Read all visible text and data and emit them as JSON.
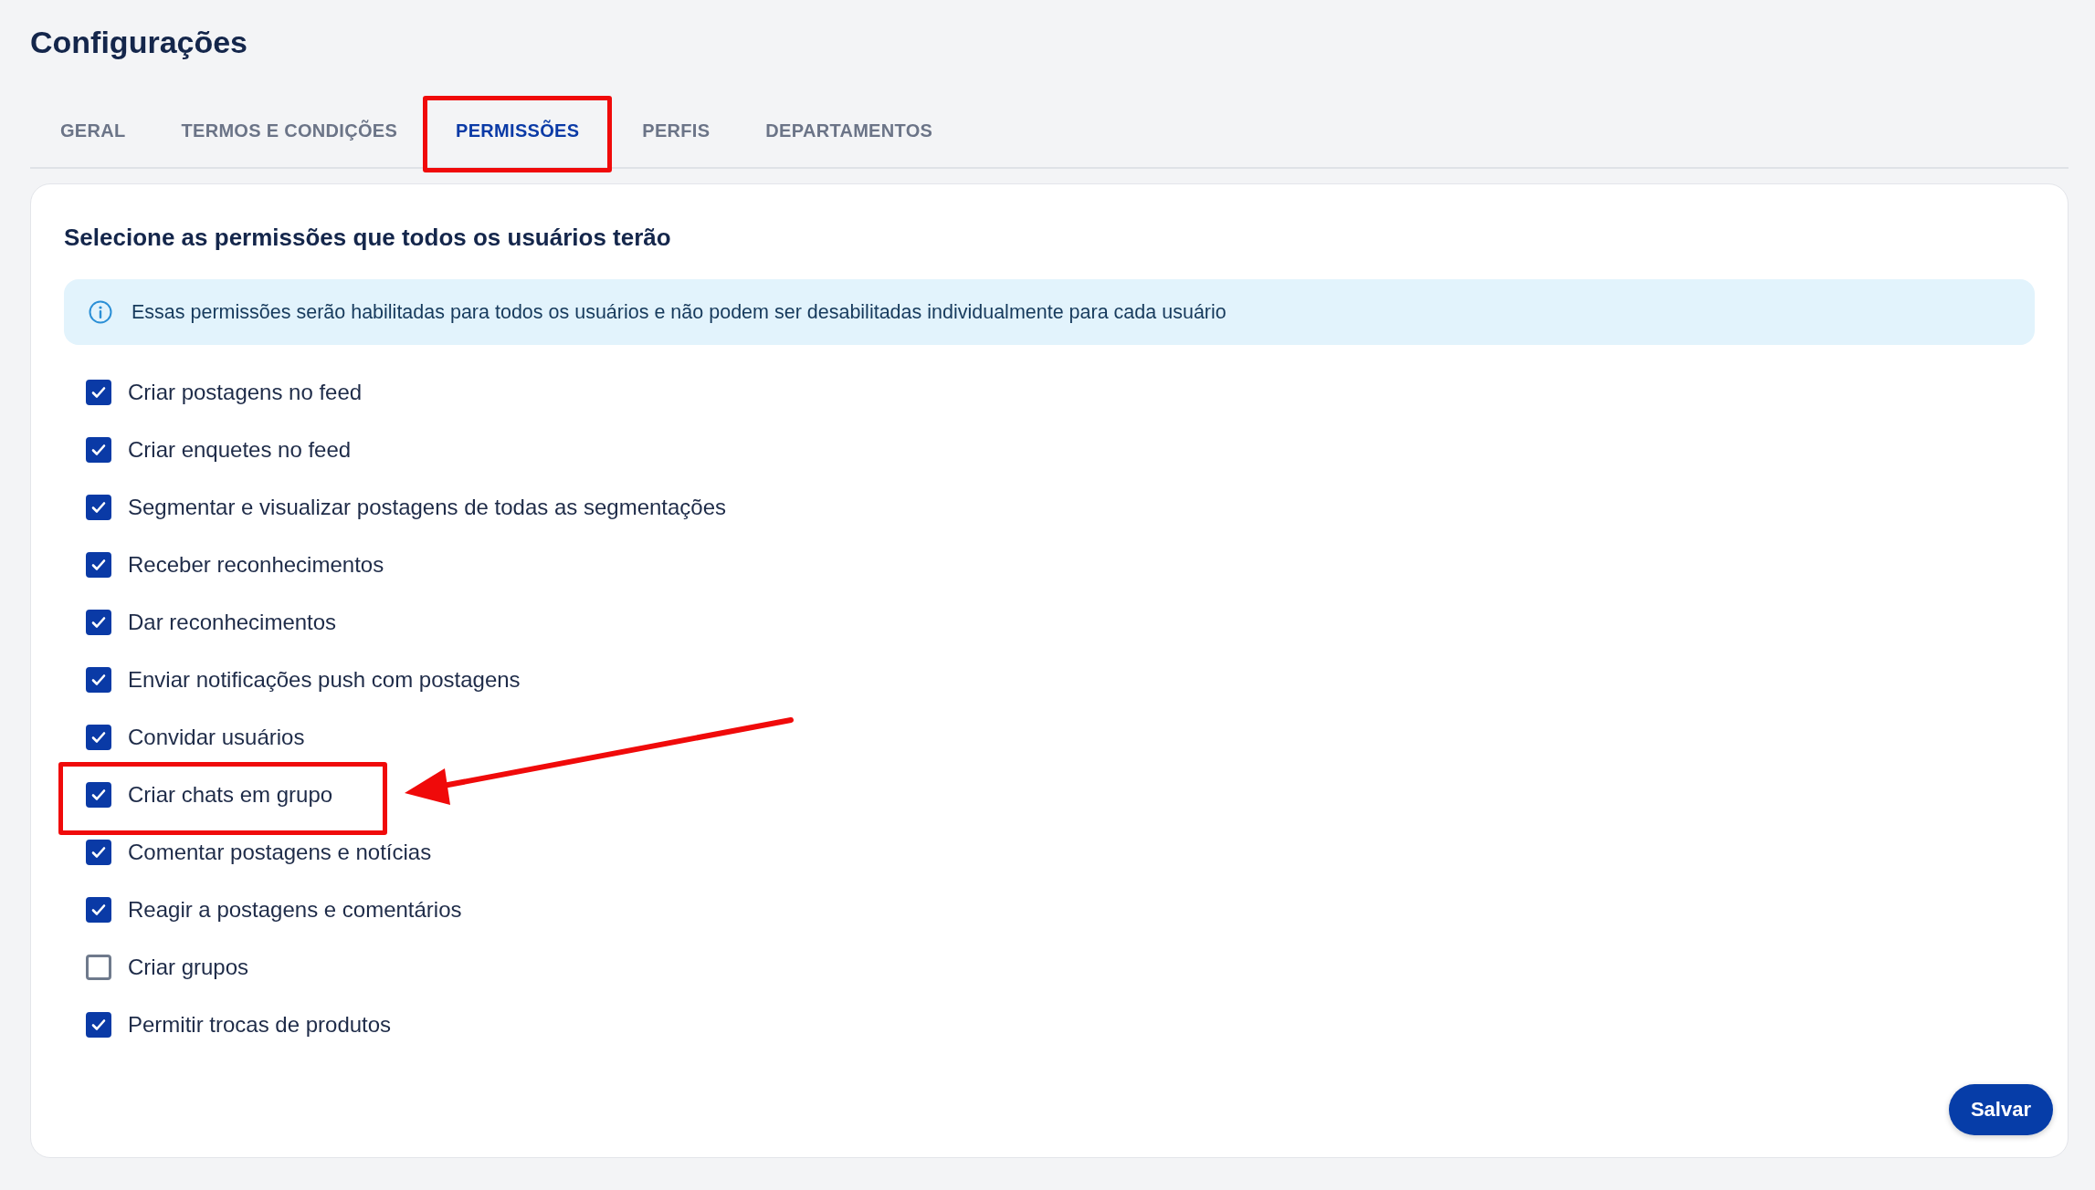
{
  "page": {
    "title": "Configurações"
  },
  "tabs": [
    {
      "label": "GERAL",
      "selected": false,
      "highlighted": false
    },
    {
      "label": "TERMOS E CONDIÇÕES",
      "selected": false,
      "highlighted": false
    },
    {
      "label": "PERMISSÕES",
      "selected": true,
      "highlighted": true
    },
    {
      "label": "PERFIS",
      "selected": false,
      "highlighted": false
    },
    {
      "label": "DEPARTAMENTOS",
      "selected": false,
      "highlighted": false
    }
  ],
  "card": {
    "heading": "Selecione as permissões que todos os usuários terão",
    "info": "Essas permissões serão habilitadas para todos os usuários e não podem ser desabilitadas individualmente para cada usuário",
    "permissions": [
      {
        "label": "Criar postagens no feed",
        "checked": true,
        "highlighted": false
      },
      {
        "label": "Criar enquetes no feed",
        "checked": true,
        "highlighted": false
      },
      {
        "label": "Segmentar e visualizar postagens de todas as segmentações",
        "checked": true,
        "highlighted": false
      },
      {
        "label": "Receber reconhecimentos",
        "checked": true,
        "highlighted": false
      },
      {
        "label": "Dar reconhecimentos",
        "checked": true,
        "highlighted": false
      },
      {
        "label": "Enviar notificações push com postagens",
        "checked": true,
        "highlighted": false
      },
      {
        "label": "Convidar usuários",
        "checked": true,
        "highlighted": false
      },
      {
        "label": "Criar chats em grupo",
        "checked": true,
        "highlighted": true
      },
      {
        "label": "Comentar postagens e notícias",
        "checked": true,
        "highlighted": false
      },
      {
        "label": "Reagir a postagens e comentários",
        "checked": true,
        "highlighted": false
      },
      {
        "label": "Criar grupos",
        "checked": false,
        "highlighted": false
      },
      {
        "label": "Permitir trocas de produtos",
        "checked": true,
        "highlighted": false
      }
    ],
    "save_button": "Salvar"
  }
}
